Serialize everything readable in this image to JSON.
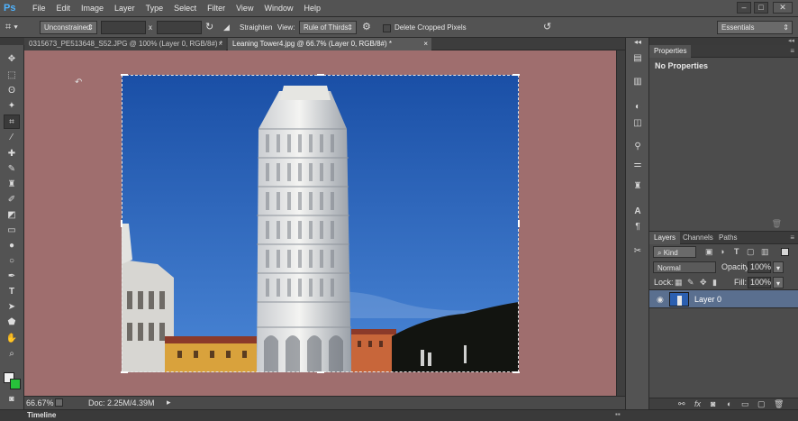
{
  "app": {
    "logo": "Ps",
    "menu": [
      "File",
      "Edit",
      "Image",
      "Layer",
      "Type",
      "Select",
      "Filter",
      "View",
      "Window",
      "Help"
    ],
    "window_controls": [
      "–",
      "□",
      "✕"
    ]
  },
  "options": {
    "ratio_value": "Unconstrained",
    "x_label": "x",
    "straighten_label": "Straighten",
    "view_label": "View:",
    "view_value": "Rule of Thirds",
    "delete_cropped_label": "Delete Cropped Pixels",
    "workspace_value": "Essentials"
  },
  "tabs": [
    {
      "label": "0315673_PE513648_S52.JPG @ 100% (Layer 0, RGB/8#) *",
      "active": false
    },
    {
      "label": "Leaning Tower4.jpg @ 66.7% (Layer 0, RGB/8#) *",
      "active": true
    }
  ],
  "tools": [
    "move",
    "marquee",
    "lasso",
    "quick-select",
    "crop",
    "eyedropper",
    "healing",
    "brush",
    "clone-stamp",
    "history-brush",
    "eraser",
    "gradient",
    "blur",
    "dodge",
    "pen",
    "type",
    "path-select",
    "shape",
    "hand",
    "zoom"
  ],
  "status": {
    "zoom": "66.67%",
    "doc": "Doc: 2.25M/4.39M"
  },
  "timeline": {
    "label": "Timeline"
  },
  "properties": {
    "tab": "Properties",
    "body": "No Properties"
  },
  "layers": {
    "tabs": [
      "Layers",
      "Channels",
      "Paths"
    ],
    "filter_value": "Kind",
    "blend_mode": "Normal",
    "opacity_label": "Opacity:",
    "opacity_value": "100%",
    "lock_label": "Lock:",
    "fill_label": "Fill:",
    "fill_value": "100%",
    "layer_name": "Layer 0"
  },
  "colors": {
    "pasteboard": "#9f6e6e",
    "sky_top": "#1a4fa6",
    "sky_bottom": "#4a86d6",
    "selected_layer": "#5a6f8f"
  }
}
